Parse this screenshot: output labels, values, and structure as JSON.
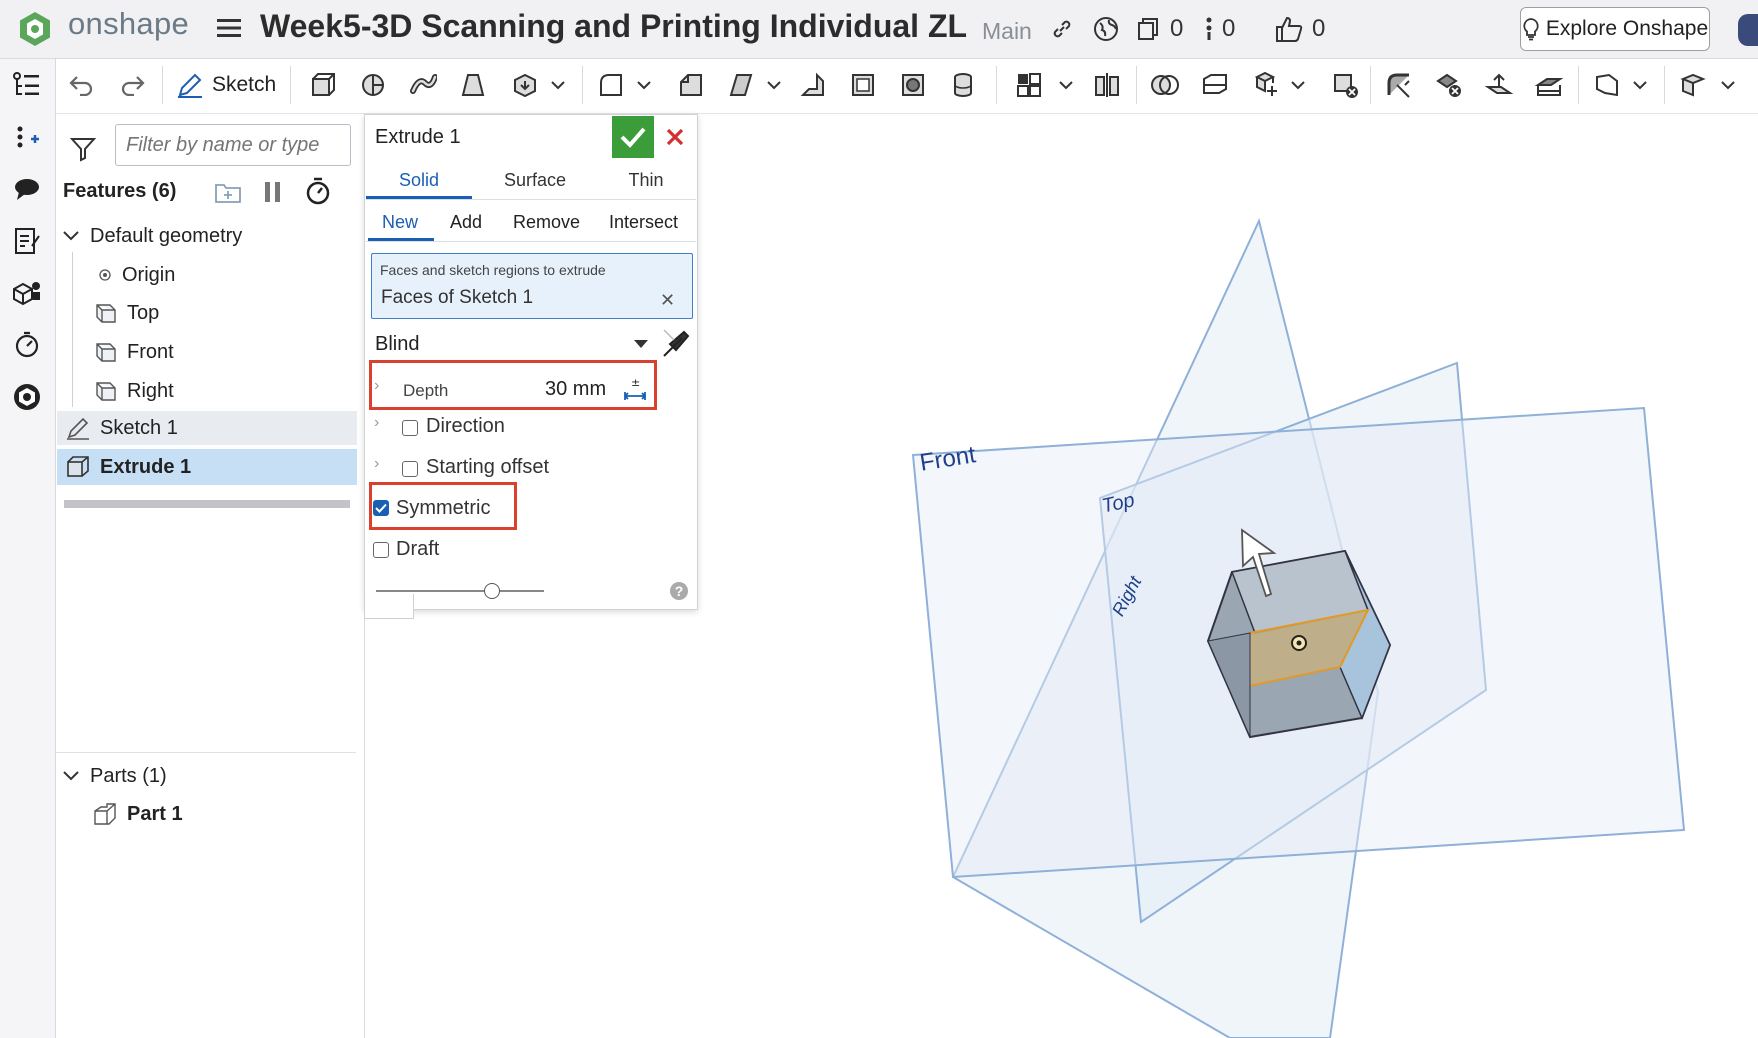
{
  "app": {
    "brand": "onshape",
    "document_title": "Week5-3D Scanning and Printing Individual ZL",
    "branch": "Main"
  },
  "topbar": {
    "versions_count": "0",
    "info_count": "0",
    "likes_count": "0",
    "explore_label": "Explore Onshape"
  },
  "toolbar": {
    "sketch_label": "Sketch"
  },
  "feature_panel": {
    "filter_placeholder": "Filter by name or type",
    "features_title": "Features (6)",
    "default_geometry": "Default geometry",
    "items": [
      "Origin",
      "Top",
      "Front",
      "Right"
    ],
    "sketch": "Sketch 1",
    "extrude": "Extrude 1",
    "parts_title": "Parts (1)",
    "part": "Part 1"
  },
  "dialog": {
    "title": "Extrude 1",
    "tabs": [
      "Solid",
      "Surface",
      "Thin"
    ],
    "ops": [
      "New",
      "Add",
      "Remove",
      "Intersect"
    ],
    "selection_label": "Faces and sketch regions to extrude",
    "selection_value": "Faces of Sketch 1",
    "end_type": "Blind",
    "depth_label": "Depth",
    "depth_value": "30 mm",
    "options": {
      "direction": "Direction",
      "starting_offset": "Starting offset",
      "symmetric": "Symmetric",
      "draft": "Draft"
    },
    "symmetric_checked": true
  },
  "viewport": {
    "plane_labels": {
      "front": "Front",
      "top": "Top",
      "right": "Right"
    }
  },
  "colors": {
    "accent": "#1a5fb4",
    "ok_green": "#3a9d3a",
    "cancel_red": "#d32f2f",
    "highlight_red": "#d9402e",
    "plane_stroke": "#8fb0d8"
  }
}
